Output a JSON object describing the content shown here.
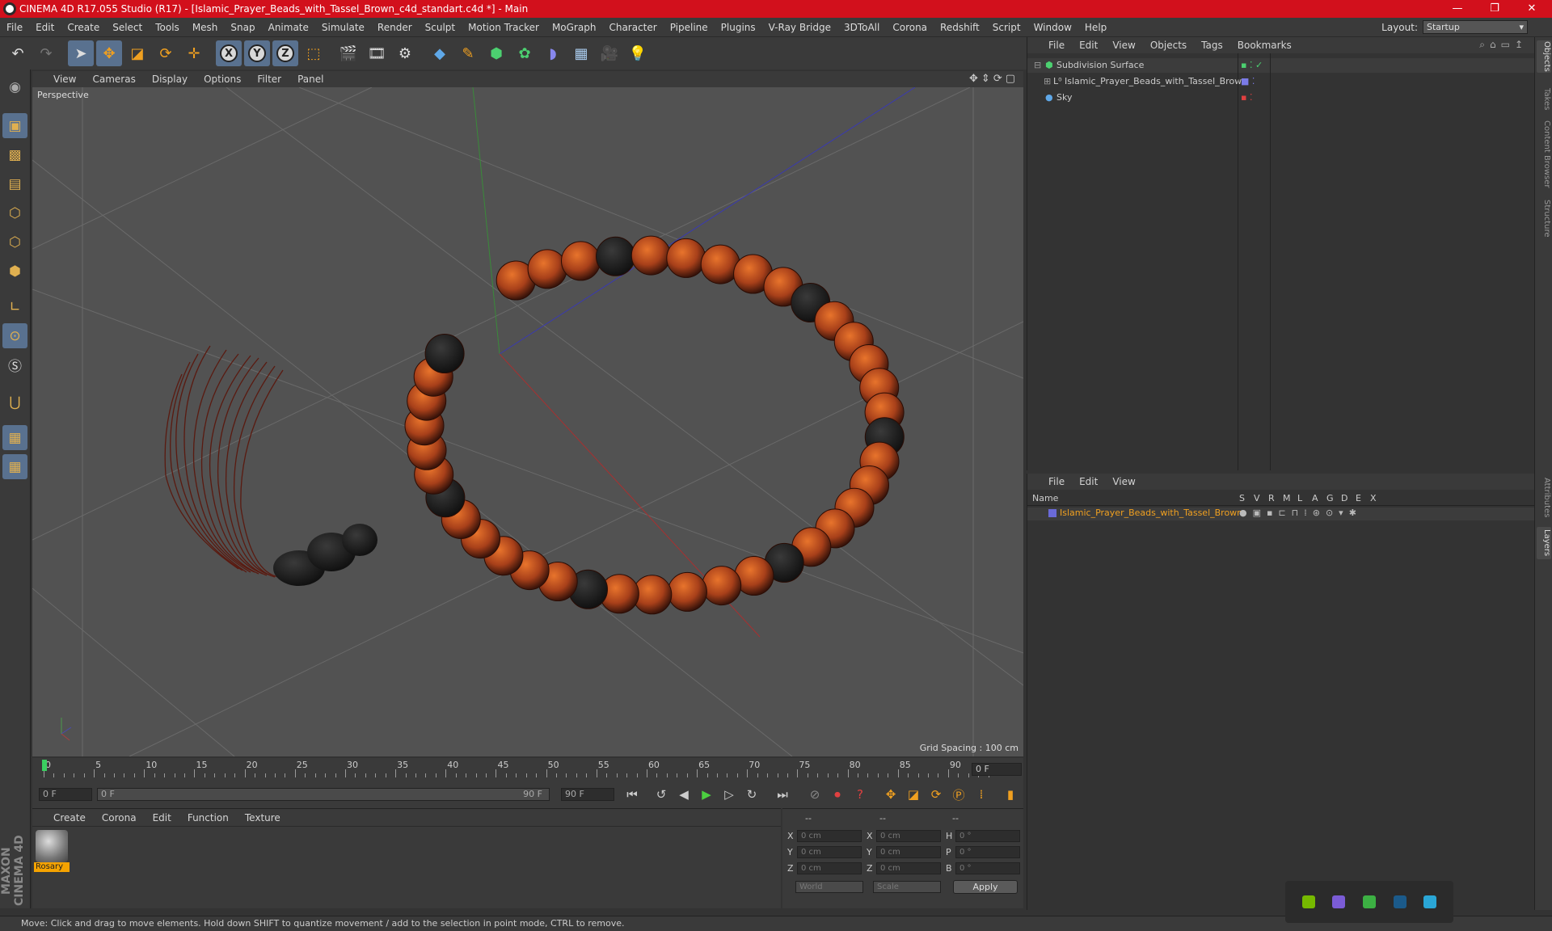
{
  "window": {
    "title": "CINEMA 4D R17.055 Studio (R17) - [Islamic_Prayer_Beads_with_Tassel_Brown_c4d_standart.c4d *] - Main"
  },
  "menubar": [
    "File",
    "Edit",
    "Create",
    "Select",
    "Tools",
    "Mesh",
    "Snap",
    "Animate",
    "Simulate",
    "Render",
    "Sculpt",
    "Motion Tracker",
    "MoGraph",
    "Character",
    "Pipeline",
    "Plugins",
    "V-Ray Bridge",
    "3DToAll",
    "Corona",
    "Redshift",
    "Script",
    "Window",
    "Help"
  ],
  "layout": {
    "label": "Layout:",
    "value": "Startup"
  },
  "viewport": {
    "menu": [
      "View",
      "Cameras",
      "Display",
      "Options",
      "Filter",
      "Panel"
    ],
    "camera": "Perspective",
    "grid_spacing": "Grid Spacing : 100 cm"
  },
  "timeline": {
    "ticks": [
      "0",
      "5",
      "10",
      "15",
      "20",
      "25",
      "30",
      "35",
      "40",
      "45",
      "50",
      "55",
      "60",
      "65",
      "70",
      "75",
      "80",
      "85",
      "90"
    ],
    "current_frame": "0 F",
    "start_field": "0 F",
    "slider_start": "0 F",
    "slider_end": "90 F",
    "end_field": "90 F"
  },
  "material_panel": {
    "menu": [
      "Create",
      "Corona",
      "Edit",
      "Function",
      "Texture"
    ],
    "material_name": "Rosary"
  },
  "attributes": {
    "header": [
      "--",
      "--",
      "--"
    ],
    "rows": [
      {
        "a": "X",
        "av": "0 cm",
        "b": "X",
        "bv": "0 cm",
        "c": "H",
        "cv": "0 °"
      },
      {
        "a": "Y",
        "av": "0 cm",
        "b": "Y",
        "bv": "0 cm",
        "c": "P",
        "cv": "0 °"
      },
      {
        "a": "Z",
        "av": "0 cm",
        "b": "Z",
        "bv": "0 cm",
        "c": "B",
        "cv": "0 °"
      }
    ],
    "coord_mode": "World",
    "size_mode": "Scale",
    "apply": "Apply"
  },
  "object_manager": {
    "menu": [
      "File",
      "Edit",
      "View",
      "Objects",
      "Tags",
      "Bookmarks"
    ],
    "objects": [
      {
        "name": "Subdivision Surface"
      },
      {
        "name": "Islamic_Prayer_Beads_with_Tassel_Brown"
      },
      {
        "name": "Sky"
      }
    ]
  },
  "layer_manager": {
    "menu": [
      "File",
      "Edit",
      "View"
    ],
    "columns": [
      "Name",
      "S",
      "V",
      "R",
      "M",
      "L",
      "A",
      "G",
      "D",
      "E",
      "X"
    ],
    "layers": [
      {
        "name": "Islamic_Prayer_Beads_with_Tassel_Brown",
        "color": "#6a6ad8"
      }
    ]
  },
  "side_tabs": [
    "Objects",
    "Takes",
    "Content Browser",
    "Structure",
    "Attributes",
    "Layers"
  ],
  "status": "Move: Click and drag to move elements. Hold down SHIFT to quantize movement / add to the selection in point mode, CTRL to remove.",
  "colors": {
    "accent": "#59718f",
    "title": "#d2101c",
    "material": "#f5a300",
    "bead": "#c0501a"
  }
}
